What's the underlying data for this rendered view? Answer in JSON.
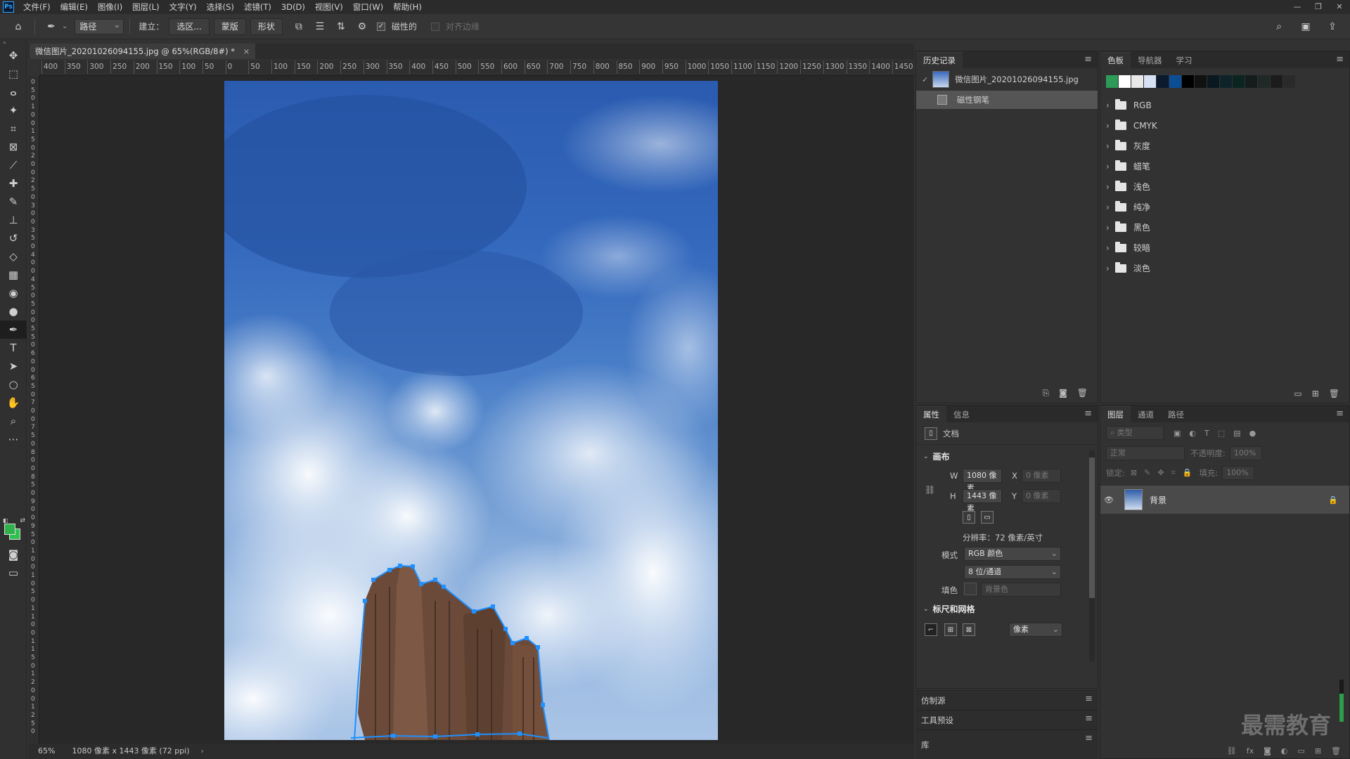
{
  "app": {
    "logo": "Ps"
  },
  "menu": [
    "文件(F)",
    "编辑(E)",
    "图像(I)",
    "图层(L)",
    "文字(Y)",
    "选择(S)",
    "滤镜(T)",
    "3D(D)",
    "视图(V)",
    "窗口(W)",
    "帮助(H)"
  ],
  "window_controls": {
    "minimize": "—",
    "restore": "❐",
    "close": "✕"
  },
  "options": {
    "mode_select": "路径",
    "make_label": "建立：",
    "selection_btn": "选区...",
    "mask_btn": "蒙版",
    "shape_btn": "形状",
    "magnetic_label": "磁性的",
    "align_edges_label": "对齐边缘"
  },
  "document": {
    "tab_title": "微信图片_20201026094155.jpg @ 65%(RGB/8#) *",
    "tab_close": "×",
    "status_zoom": "65%",
    "status_info": "1080 像素 x 1443 像素 (72 ppi)",
    "status_arrow": "›"
  },
  "ruler_top": [
    "400",
    "350",
    "300",
    "250",
    "200",
    "150",
    "100",
    "50",
    "0",
    "50",
    "100",
    "150",
    "200",
    "250",
    "300",
    "350",
    "400",
    "450",
    "500",
    "550",
    "600",
    "650",
    "700",
    "750",
    "800",
    "850",
    "900",
    "950",
    "1000",
    "1050",
    "1100",
    "1150",
    "1200",
    "1250",
    "1300",
    "1350",
    "1400",
    "1450"
  ],
  "ruler_left": [
    "0",
    "5",
    "0",
    "1",
    "0",
    "0",
    "1",
    "5",
    "0",
    "2",
    "0",
    "0",
    "2",
    "5",
    "0",
    "3",
    "0",
    "0",
    "3",
    "5",
    "0",
    "4",
    "0",
    "0",
    "4",
    "5",
    "0",
    "5",
    "0",
    "0",
    "5",
    "5",
    "0",
    "6",
    "0",
    "0",
    "6",
    "5",
    "0",
    "7",
    "0",
    "0",
    "7",
    "5",
    "0",
    "8",
    "0",
    "0",
    "8",
    "5",
    "0",
    "9",
    "0",
    "0",
    "9",
    "5",
    "0",
    "1",
    "0",
    "0",
    "1",
    "0",
    "5",
    "0",
    "1",
    "1",
    "0",
    "0",
    "1",
    "1",
    "5",
    "0",
    "1",
    "2",
    "0",
    "0",
    "1",
    "2",
    "5",
    "0"
  ],
  "history": {
    "tab": "历史记录",
    "snapshot": "微信图片_20201026094155.jpg",
    "step": "磁性钢笔"
  },
  "swatches": {
    "tabs": [
      "色板",
      "导航器",
      "学习"
    ],
    "colors": [
      "#2e9a57",
      "#ffffff",
      "#e8e8e8",
      "#d7e3f5",
      "#0b1a2e",
      "#0c4e96",
      "#000000",
      "#111111",
      "#0a1820",
      "#0e2329",
      "#0a2420",
      "#141c1c",
      "#202828",
      "#1c1c1c",
      "#2a2a2a"
    ],
    "groups": [
      "RGB",
      "CMYK",
      "灰度",
      "蜡笔",
      "浅色",
      "纯净",
      "黑色",
      "较暗",
      "淡色"
    ]
  },
  "properties": {
    "tabs": [
      "属性",
      "信息"
    ],
    "doc_label": "文档",
    "canvas_head": "画布",
    "w_label": "W",
    "w_value": "1080 像素",
    "x_label": "X",
    "x_placeholder": "0 像素",
    "h_label": "H",
    "h_value": "1443 像素",
    "y_label": "Y",
    "y_placeholder": "0 像素",
    "resolution": "分辨率：72 像素/英寸",
    "mode_label": "模式",
    "mode_value": "RGB 颜色",
    "depth_value": "8 位/通道",
    "fill_label": "填色",
    "fill_value": "背景色",
    "rulers_head": "标尺和网格",
    "units_value": "像素"
  },
  "collapsed_panels": [
    "仿制源",
    "工具预设",
    "库"
  ],
  "layers": {
    "tabs": [
      "图层",
      "通道",
      "路径"
    ],
    "filter_placeholder": "类型",
    "blend_mode": "正常",
    "opacity_label": "不透明度:",
    "opacity_value": "100%",
    "lock_label": "锁定:",
    "fill_label": "填充:",
    "fill_value": "100%",
    "layer_name": "背景"
  },
  "watermark": "最需教育"
}
